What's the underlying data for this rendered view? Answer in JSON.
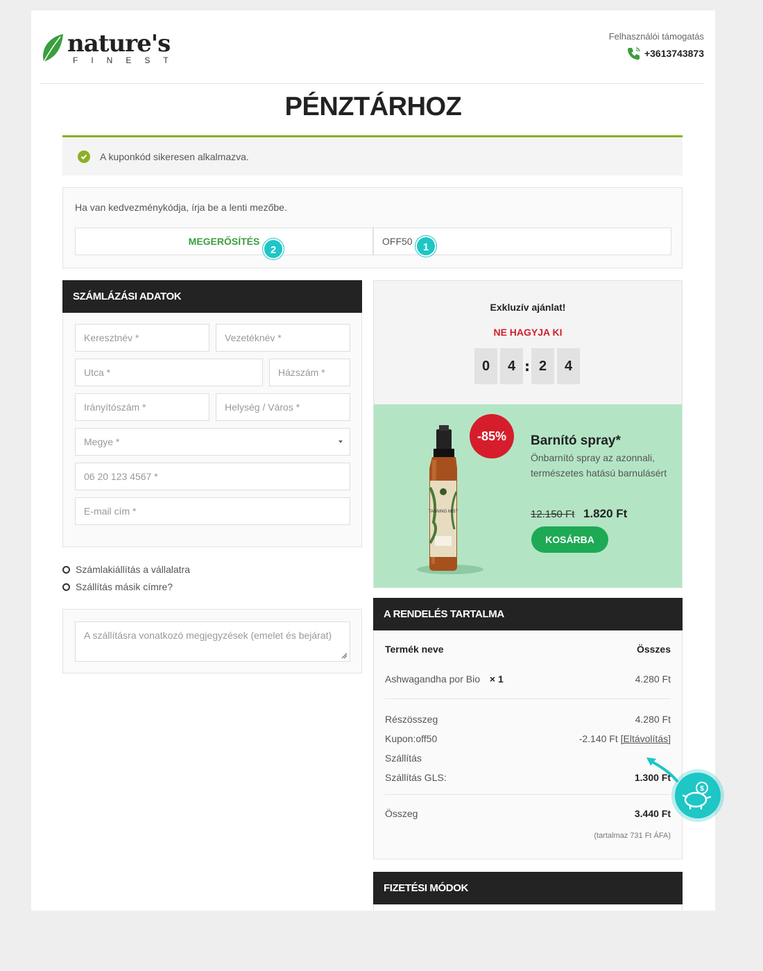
{
  "brand": {
    "name": "nature's",
    "sub": "FINEST",
    "leaf_color": "#3a9e3f"
  },
  "support": {
    "label": "Felhasználói támogatás",
    "phone": "+3613743873"
  },
  "page_title": "PÉNZTÁRHOZ",
  "notice": {
    "text": "A kuponkód sikeresen alkalmazva.",
    "icon": "check-circle-icon"
  },
  "coupon": {
    "prompt": "Ha van kedvezménykódja, írja be a lenti mezőbe.",
    "apply_label": "MEGERŐSÍTÉS",
    "code_value": "OFF50",
    "step_apply": "2",
    "step_code": "1"
  },
  "billing": {
    "heading": "SZÁMLÁZÁSI ADATOK",
    "first_name": "Keresztnév *",
    "last_name": "Vezetéknév *",
    "street": "Utca *",
    "house_no": "Házszám *",
    "zip": "Irányítószám *",
    "city": "Helység / Város *",
    "county": "Megye *",
    "phone": "06 20 123 4567 *",
    "email": "E-mail cím *"
  },
  "options": {
    "company_invoice": "Számlakiállítás a vállalatra",
    "other_address": "Szállítás másik címre?"
  },
  "notes_placeholder": "A szállításra vonatkozó megjegyzések (emelet és bejárat)",
  "offer": {
    "title": "Exkluzív ajánlat!",
    "subtitle": "NE HAGYJA KI",
    "timer": [
      "0",
      "4",
      "2",
      "4"
    ],
    "discount": "-85%",
    "product_name": "Barnító spray*",
    "product_desc": "Önbarnító spray az azonnali, természetes hatású barnulásért",
    "old_price": "12.150 Ft",
    "new_price": "1.820 Ft",
    "cart_label": "KOSÁRBA",
    "product_label": "TANNING MIST"
  },
  "order": {
    "heading": "A RENDELÉS TARTALMA",
    "col_product": "Termék neve",
    "col_total": "Összes",
    "item_name": "Ashwagandha por Bio",
    "item_qty": "× 1",
    "item_total": "4.280 Ft",
    "subtotal_label": "Részösszeg",
    "subtotal": "4.280 Ft",
    "coupon_label": "Kupon:off50",
    "coupon_value": "-2.140 Ft",
    "coupon_remove": "[Eltávolítás]",
    "shipping_label": "Szállítás",
    "gls_label": "Szállítás GLS:",
    "gls_value": "1.300 Ft",
    "total_label": "Összeg",
    "total": "3.440 Ft",
    "vat_note": "(tartalmaz 731 Ft ÁFA)"
  },
  "payment": {
    "heading": "FIZETÉSI MÓDOK"
  },
  "colors": {
    "accent_green": "#8bb026",
    "teal": "#1ec6c6",
    "red": "#d61d2c",
    "cart_green": "#1ea954",
    "promo_bg": "#b3e5c5"
  }
}
